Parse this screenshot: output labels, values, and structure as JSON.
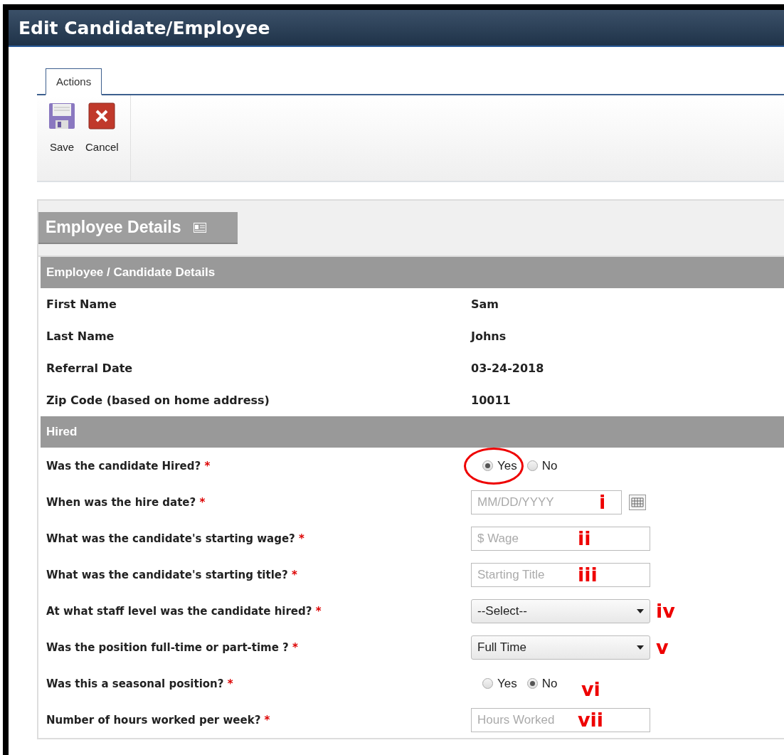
{
  "window": {
    "title": "Edit Candidate/Employee"
  },
  "tabs": [
    {
      "label": "Actions",
      "selected": true
    }
  ],
  "toolbar": [
    {
      "kind": "save",
      "label": "Save"
    },
    {
      "kind": "cancel",
      "label": "Cancel"
    }
  ],
  "panel": {
    "title": "Employee Details"
  },
  "sections": [
    {
      "title": "Employee / Candidate Details",
      "rows": [
        {
          "label": "First Name",
          "value": "Sam"
        },
        {
          "label": "Last Name",
          "value": "Johns"
        },
        {
          "label": "Referral Date",
          "value": "03-24-2018"
        },
        {
          "label": "Zip Code (based on home address)",
          "value": "10011"
        }
      ]
    },
    {
      "title": "Hired",
      "questions": [
        {
          "kind": "radio",
          "label": "Was the candidate Hired?",
          "required_mark": "*",
          "options": [
            {
              "label": "Yes",
              "selected": true,
              "circled": true
            },
            {
              "label": "No",
              "selected": false,
              "circled": false
            }
          ]
        },
        {
          "kind": "date",
          "label": "When was the hire date?",
          "required_mark": "*",
          "placeholder": "MM/DD/YYYY",
          "annotation": "i"
        },
        {
          "kind": "text",
          "label": "What was the candidate's starting wage?",
          "required_mark": "*",
          "placeholder": "$ Wage",
          "annotation": "ii"
        },
        {
          "kind": "text",
          "label": "What was the candidate's starting title?",
          "required_mark": "*",
          "placeholder": "Starting Title",
          "annotation": "iii"
        },
        {
          "kind": "select",
          "label": "At what staff level was the candidate hired?",
          "required_mark": "*",
          "value": "--Select--",
          "annotation": "iv"
        },
        {
          "kind": "select",
          "label": "Was the position full-time or part-time ?",
          "required_mark": "*",
          "value": "Full Time",
          "annotation": "v"
        },
        {
          "kind": "radio",
          "label": "Was this a seasonal position?",
          "required_mark": "*",
          "options": [
            {
              "label": "Yes",
              "selected": false,
              "circled": false
            },
            {
              "label": "No",
              "selected": true,
              "circled": false
            }
          ],
          "annotation": "vi"
        },
        {
          "kind": "text",
          "label": "Number of hours worked per week?",
          "required_mark": "*",
          "placeholder": "Hours Worked",
          "annotation": "vii"
        }
      ]
    }
  ]
}
